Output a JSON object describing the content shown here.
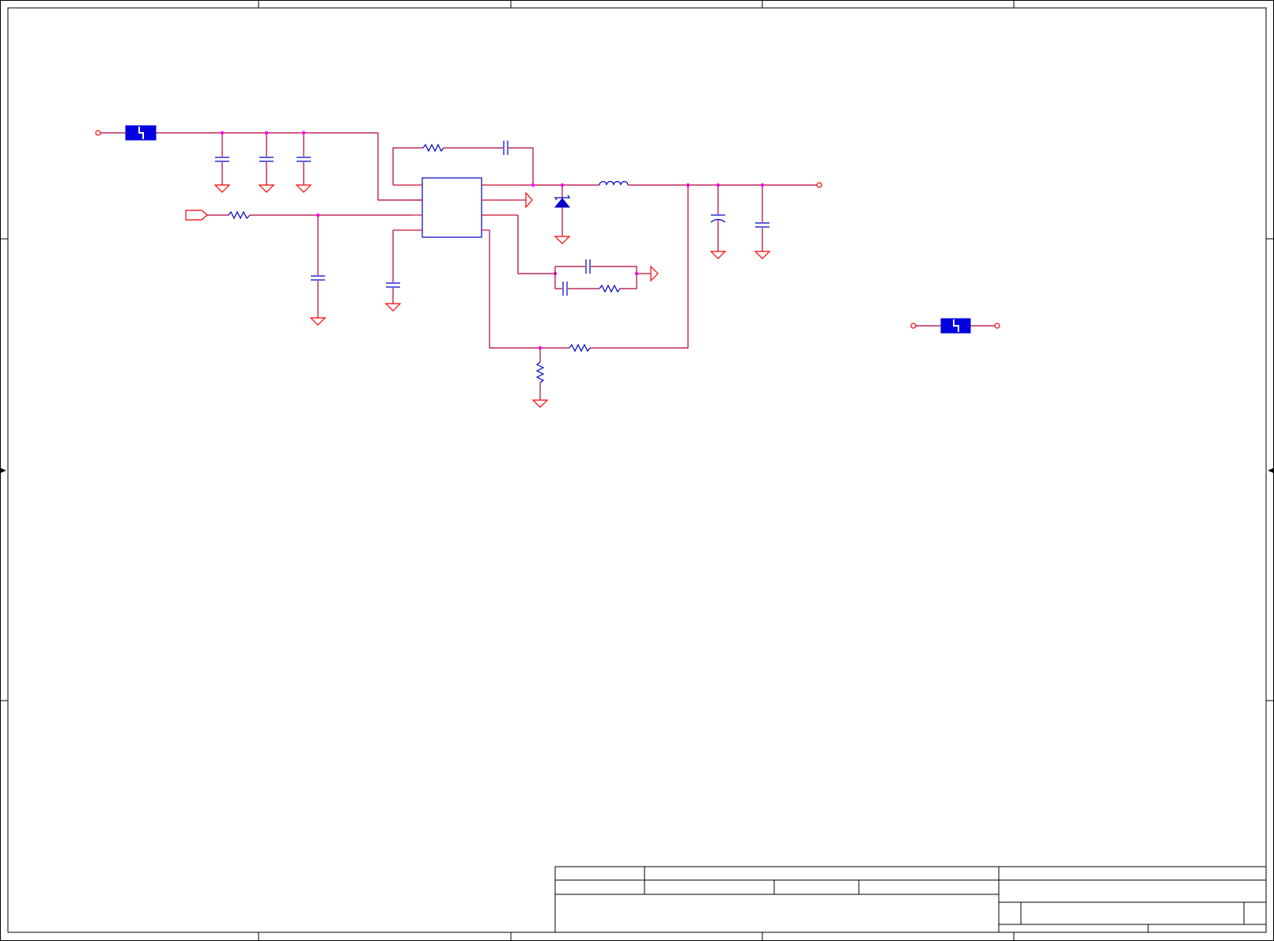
{
  "schematic": {
    "colors": {
      "wire": "#b0003c",
      "component": "#0000c8",
      "ground_symbol": "#ff0000",
      "junction": "#ff00ff",
      "frame": "#000000"
    },
    "title_block": {}
  }
}
